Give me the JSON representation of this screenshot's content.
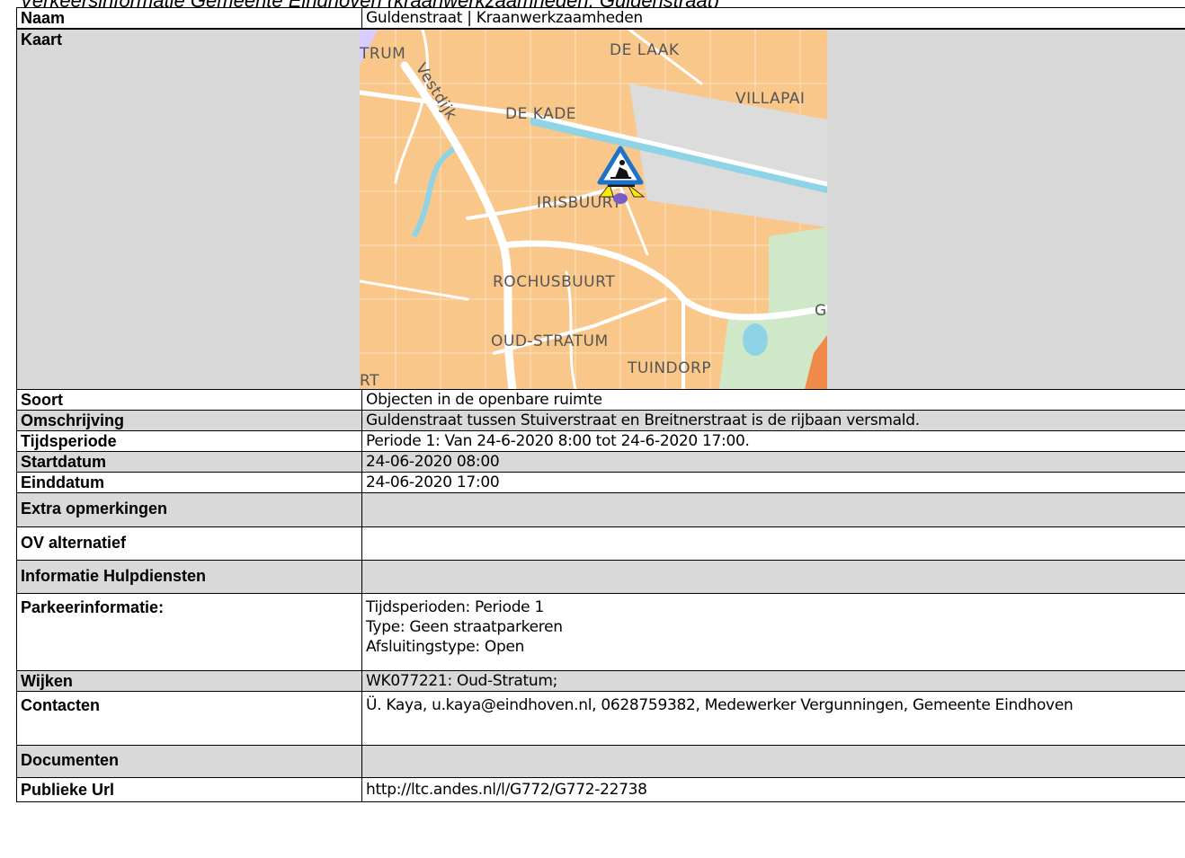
{
  "header_fragment": "Verkeersinformatie Gemeente Eindhoven (kraanwerkzaamheden, Guldenstraat)",
  "rows": {
    "naam": {
      "label": "Naam",
      "value": "Guldenstraat | Kraanwerkzaamheden"
    },
    "kaart": {
      "label": "Kaart"
    },
    "soort": {
      "label": "Soort",
      "value": "Objecten in de openbare ruimte"
    },
    "omschrijving": {
      "label": "Omschrijving",
      "value": "Guldenstraat tussen Stuiverstraat en Breitnerstraat is de rijbaan versmald."
    },
    "tijdsperiode": {
      "label": "Tijdsperiode",
      "value": "Periode 1: Van 24-6-2020 8:00 tot 24-6-2020 17:00."
    },
    "startdatum": {
      "label": "Startdatum",
      "value": "24-06-2020 08:00"
    },
    "einddatum": {
      "label": "Einddatum",
      "value": "24-06-2020 17:00"
    },
    "extra": {
      "label": "Extra opmerkingen",
      "value": ""
    },
    "ov": {
      "label": "OV alternatief",
      "value": ""
    },
    "hulpdiensten": {
      "label": "Informatie Hulpdiensten",
      "value": ""
    },
    "parkeer": {
      "label": "Parkeerinformatie:",
      "lines": [
        "Tijdsperioden: Periode 1",
        "Type: Geen straatparkeren",
        "Afsluitingstype: Open"
      ]
    },
    "wijken": {
      "label": "Wijken",
      "value": "WK077221: Oud-Stratum;"
    },
    "contacten": {
      "label": "Contacten",
      "value": "Ü. Kaya, u.kaya@eindhoven.nl, 0628759382, Medewerker Vergunningen, Gemeente Eindhoven"
    },
    "documenten": {
      "label": "Documenten",
      "value": ""
    },
    "url": {
      "label": "Publieke Url",
      "value": "http://ltc.andes.nl/l/G772/G772-22738"
    }
  },
  "map": {
    "labels": {
      "trum": "TRUM",
      "delaak": "DE LAAK",
      "villapa": "VILLAPAI",
      "vestdijk": "Vestdijk",
      "dekade": "DE KADE",
      "irisbuurt": "IRISBUURT",
      "rochusbuurt": "ROCHUSBUURT",
      "oudstratum": "OUD-STRATUM",
      "tuindorp": "TUINDORP",
      "rt": "RT",
      "g": "G"
    },
    "colors": {
      "urban": "#f9c78a",
      "road": "#ffffff",
      "water": "#8fd3e6",
      "park": "#cfe8c8",
      "industrial": "#d9d9d9"
    },
    "marker_icon": "roadworks-icon"
  }
}
